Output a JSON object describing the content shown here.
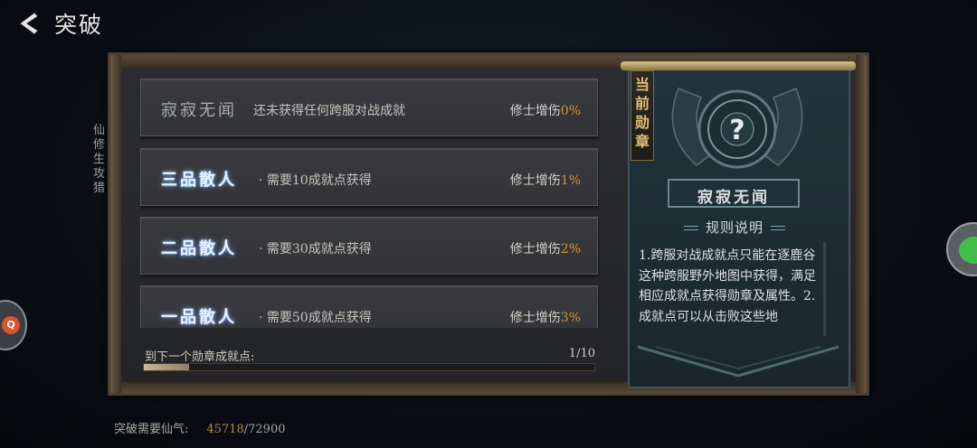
{
  "header": {
    "back_icon": "chevron-left-icon",
    "title": "突破"
  },
  "side_strategy": "仙修生攻猎",
  "ranks": [
    {
      "name": "寂寂无闻",
      "style": "dim",
      "desc": "还未获得任何跨服对战成就",
      "bonus_label": "修士增伤",
      "bonus_pct": "0%"
    },
    {
      "name": "三品散人",
      "style": "glow",
      "desc": "·  需要10成就点获得",
      "bonus_label": "修士增伤",
      "bonus_pct": "1%"
    },
    {
      "name": "二品散人",
      "style": "glow",
      "desc": "·  需要30成就点获得",
      "bonus_label": "修士增伤",
      "bonus_pct": "2%"
    },
    {
      "name": "一品散人",
      "style": "glow",
      "desc": "·  需要50成就点获得",
      "bonus_label": "修士增伤",
      "bonus_pct": "3%"
    }
  ],
  "progress": {
    "label": "到下一个勋章成就点:",
    "count": "1/10",
    "fraction": 0.1
  },
  "medal": {
    "tag": "当前勋章",
    "emblem_icon": "question-mark-icon",
    "name": "寂寂无闻",
    "rules_title": "规则说明",
    "rules_text": "1.跨服对战成就点只能在逐鹿谷这种跨服野外地图中获得，满足相应成就点获得勋章及属性。2.成就点可以从击败这些地"
  },
  "footer": {
    "label": "突破需要仙气:",
    "current": "45718",
    "max": "/72900"
  },
  "colors": {
    "accent_orange": "#d8923a",
    "glow_blue": "#7fb2ff",
    "gold": "#e2c07a"
  }
}
